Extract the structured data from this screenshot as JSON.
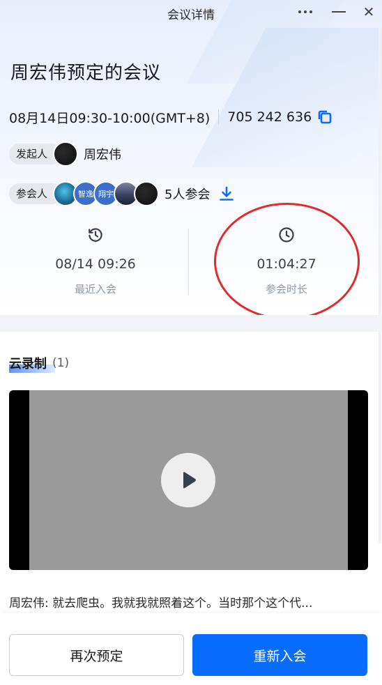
{
  "window": {
    "title": "会议详情"
  },
  "meeting": {
    "title": "周宏伟预定的会议",
    "time": "08月14日09:30-10:00(GMT+8)",
    "meeting_id": "705 242 636"
  },
  "organizer": {
    "label": "发起人",
    "name": "周宏伟"
  },
  "participants": {
    "label": "参会人",
    "avatars": [
      "",
      "智逸",
      "翔宇",
      "",
      ""
    ],
    "count_text": "5人参会"
  },
  "stats": {
    "recent_join": {
      "value": "08/14 09:26",
      "label": "最近入会"
    },
    "duration": {
      "value": "01:04:27",
      "label": "参会时长"
    }
  },
  "recording": {
    "title": "云录制",
    "count": "(1)",
    "transcript_speaker": "周宏伟:",
    "transcript_text": "就去爬虫。我就我就照着这个。当时那个这个代..."
  },
  "actions": {
    "rebook_label": "再次预定",
    "rejoin_label": "重新入会"
  },
  "colors": {
    "accent": "#0a6cff",
    "annotation": "#e12a2a"
  }
}
